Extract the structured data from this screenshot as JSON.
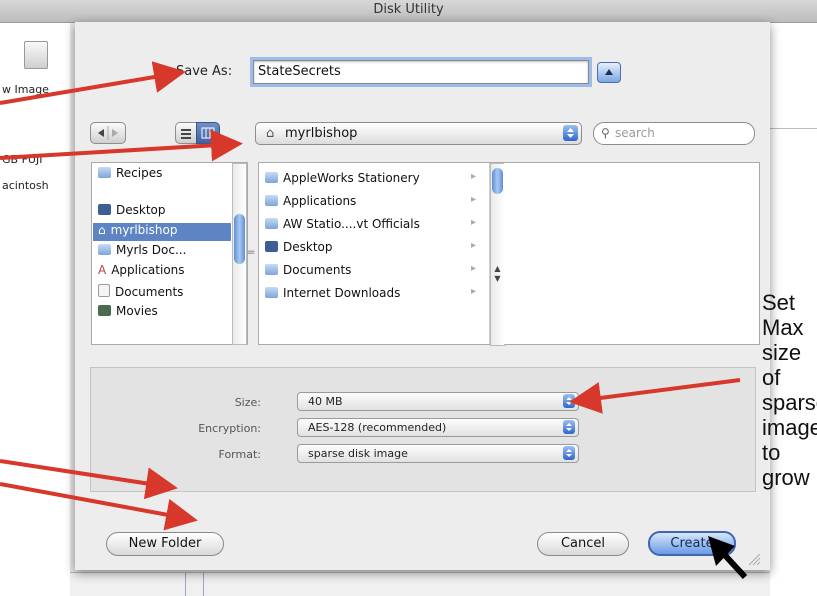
{
  "window": {
    "title": "Disk Utility"
  },
  "sidebar": {
    "items": [
      "w Image",
      "GB FUJI",
      "acintosh"
    ]
  },
  "save_as": {
    "label": "Save As:",
    "value": "StateSecrets"
  },
  "location": {
    "folder": "myrlbishop",
    "search_placeholder": "search"
  },
  "places": [
    {
      "label": "Recipes",
      "selected": false
    },
    {
      "label": "Desktop",
      "selected": false
    },
    {
      "label": "myrlbishop",
      "selected": true
    },
    {
      "label": "Myrls Doc...",
      "selected": false
    },
    {
      "label": "Applications",
      "selected": false
    },
    {
      "label": "Documents",
      "selected": false
    },
    {
      "label": "Movies",
      "selected": false
    }
  ],
  "files": [
    {
      "label": "AppleWorks Stationery",
      "arrow": "▸"
    },
    {
      "label": "Applications",
      "arrow": "▸"
    },
    {
      "label": "AW Statio....vt Officials",
      "arrow": "▸"
    },
    {
      "label": "Desktop",
      "arrow": "▸"
    },
    {
      "label": "Documents",
      "arrow": "▸"
    },
    {
      "label": "Internet Downloads",
      "arrow": "▸"
    }
  ],
  "options": {
    "size_label": "Size:",
    "size_value": "40 MB",
    "encryption_label": "Encryption:",
    "encryption_value": "AES-128 (recommended)",
    "format_label": "Format:",
    "format_value": "sparse disk image"
  },
  "buttons": {
    "new_folder": "New Folder",
    "cancel": "Cancel",
    "create": "Create"
  },
  "annotation": {
    "text": "Set Max size of sparse image to grow"
  },
  "colors": {
    "arrow": "#d8372c",
    "selection": "#5e84c4",
    "accent_button": "#6c9ae3"
  },
  "icons": [
    "back-icon",
    "forward-icon",
    "list-view-icon",
    "column-view-icon",
    "home-folder-icon",
    "search-icon",
    "folder-icon",
    "cursor-icon"
  ]
}
